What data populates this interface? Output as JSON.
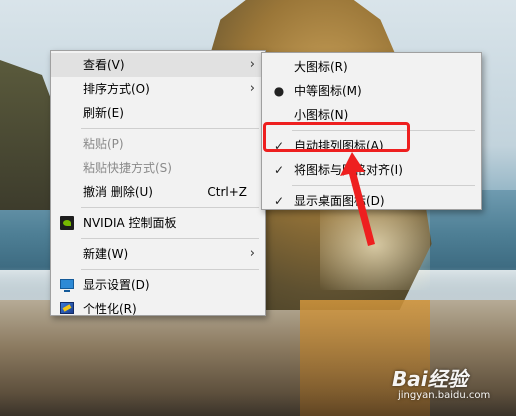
{
  "main_menu": {
    "items": [
      {
        "label": "查看(V)",
        "has_submenu": true
      },
      {
        "label": "排序方式(O)",
        "has_submenu": true
      },
      {
        "label": "刷新(E)"
      },
      {
        "label": "粘贴(P)",
        "disabled": true
      },
      {
        "label": "粘贴快捷方式(S)",
        "disabled": true
      },
      {
        "label": "撤消 删除(U)",
        "shortcut": "Ctrl+Z"
      },
      {
        "label": "NVIDIA 控制面板",
        "icon": "nvidia-icon"
      },
      {
        "label": "新建(W)",
        "has_submenu": true
      },
      {
        "label": "显示设置(D)",
        "icon": "display-icon"
      },
      {
        "label": "个性化(R)",
        "icon": "personalize-icon"
      }
    ]
  },
  "sub_menu": {
    "items": [
      {
        "label": "大图标(R)"
      },
      {
        "label": "中等图标(M)",
        "selected": true
      },
      {
        "label": "小图标(N)"
      },
      {
        "label": "自动排列图标(A)",
        "checked": true,
        "highlighted": true
      },
      {
        "label": "将图标与网格对齐(I)",
        "checked": true
      },
      {
        "label": "显示桌面图标(D)",
        "checked": true
      }
    ]
  },
  "symbols": {
    "arrow": "›",
    "check": "✓",
    "bullet": "●"
  },
  "watermark": {
    "brand": "Bai经验",
    "site": "jingyan.baidu.com"
  },
  "colors": {
    "menu_bg": "#f2f2f2",
    "annotation_red": "#ee1f1f"
  }
}
